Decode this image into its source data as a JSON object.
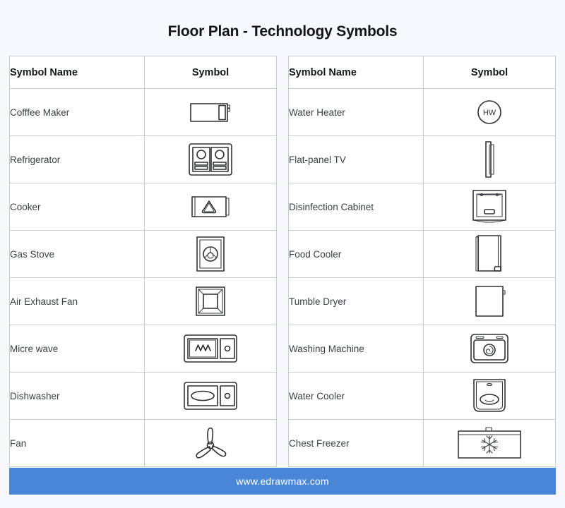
{
  "page": {
    "title": "Floor Plan - Technology Symbols",
    "background_color": "#f6f8fc",
    "accent_color": "#4a86d8"
  },
  "left_table": {
    "headers": {
      "name": "Symbol Name",
      "symbol": "Symbol"
    },
    "rows": [
      {
        "name": "Cofffee Maker",
        "icon": "coffee-maker-symbol"
      },
      {
        "name": "Refrigerator",
        "icon": "refrigerator-symbol"
      },
      {
        "name": "Cooker",
        "icon": "cooker-symbol"
      },
      {
        "name": "Gas Stove",
        "icon": "gas-stove-symbol"
      },
      {
        "name": "Air Exhaust Fan",
        "icon": "air-exhaust-fan-symbol"
      },
      {
        "name": "Micre wave",
        "icon": "microwave-symbol"
      },
      {
        "name": "Dishwasher",
        "icon": "dishwasher-symbol"
      },
      {
        "name": "Fan",
        "icon": "fan-symbol"
      }
    ]
  },
  "right_table": {
    "headers": {
      "name": "Symbol Name",
      "symbol": "Symbol"
    },
    "rows": [
      {
        "name": "Water Heater",
        "icon": "water-heater-symbol",
        "label": "HW"
      },
      {
        "name": "Flat-panel TV",
        "icon": "flat-panel-tv-symbol"
      },
      {
        "name": "Disinfection Cabinet",
        "icon": "disinfection-cabinet-symbol"
      },
      {
        "name": "Food Cooler",
        "icon": "food-cooler-symbol"
      },
      {
        "name": "Tumble Dryer",
        "icon": "tumble-dryer-symbol"
      },
      {
        "name": "Washing Machine",
        "icon": "washing-machine-symbol"
      },
      {
        "name": "Water Cooler",
        "icon": "water-cooler-symbol"
      },
      {
        "name": "Chest Freezer",
        "icon": "chest-freezer-symbol"
      }
    ]
  },
  "footer": {
    "url": "www.edrawmax.com"
  }
}
